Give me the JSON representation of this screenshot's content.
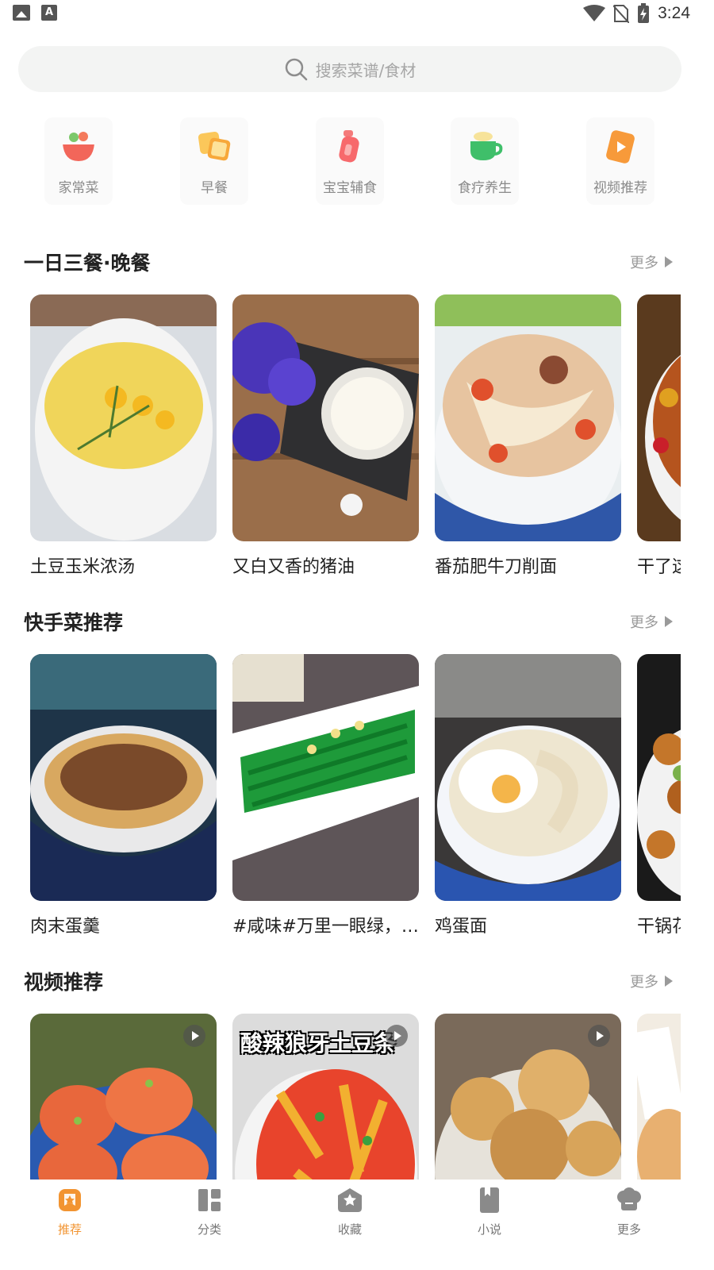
{
  "status_bar": {
    "time": "3:24",
    "icons": [
      "image-icon",
      "a-icon",
      "wifi-icon",
      "no-sim-icon",
      "battery-charging-icon"
    ]
  },
  "search": {
    "placeholder": "搜索菜谱/食材"
  },
  "categories": [
    {
      "label": "家常菜",
      "icon": "salad-bowl-icon"
    },
    {
      "label": "早餐",
      "icon": "toast-icon"
    },
    {
      "label": "宝宝辅食",
      "icon": "baby-bottle-icon"
    },
    {
      "label": "食疗养生",
      "icon": "tea-cup-icon"
    },
    {
      "label": "视频推荐",
      "icon": "video-play-icon"
    }
  ],
  "sections": [
    {
      "title": "一日三餐·晚餐",
      "more": "更多",
      "cards": [
        {
          "title": "土豆玉米浓汤"
        },
        {
          "title": "又白又香的猪油"
        },
        {
          "title": "番茄肥牛刀削面"
        },
        {
          "title": "干了这"
        }
      ]
    },
    {
      "title": "快手菜推荐",
      "more": "更多",
      "cards": [
        {
          "title": "肉末蛋羹"
        },
        {
          "title": "#咸味#万里一眼绿，清炒菜心"
        },
        {
          "title": "鸡蛋面"
        },
        {
          "title": "干锅花"
        }
      ]
    },
    {
      "title": "视频推荐",
      "more": "更多",
      "cards": [
        {
          "caption": ""
        },
        {
          "caption": "酸辣狼牙土豆条"
        },
        {
          "caption": ""
        },
        {
          "caption": ""
        }
      ]
    }
  ],
  "bottom_nav": [
    {
      "label": "推荐",
      "icon": "recommend-icon",
      "active": true
    },
    {
      "label": "分类",
      "icon": "category-icon",
      "active": false
    },
    {
      "label": "收藏",
      "icon": "favorite-icon",
      "active": false
    },
    {
      "label": "小说",
      "icon": "novel-icon",
      "active": false
    },
    {
      "label": "更多",
      "icon": "more-chef-icon",
      "active": false
    }
  ],
  "colors": {
    "accent": "#f29431",
    "search_bg": "#f3f4f3",
    "muted_text": "#9a9a9a"
  }
}
